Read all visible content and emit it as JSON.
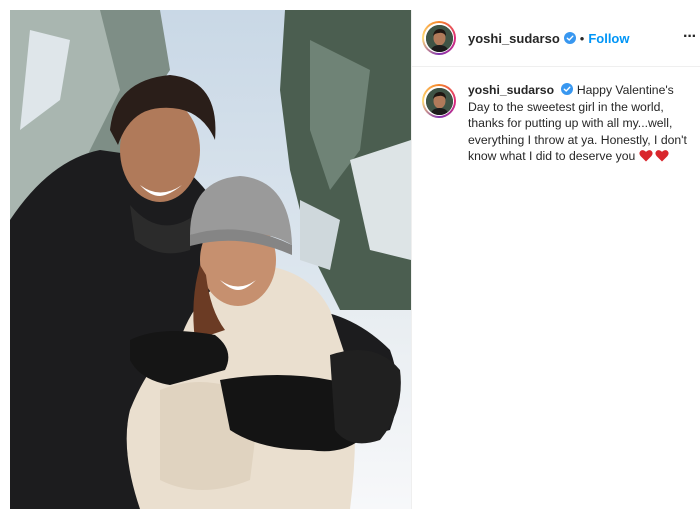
{
  "post": {
    "username": "yoshi_sudarso",
    "separator": "•",
    "follow_label": "Follow",
    "more_label": "···",
    "caption": "Happy Valentine's Day to the sweetest girl in the world, thanks for putting up with all my...well, everything I throw at ya. Honestly, I don't know what I did to deserve you",
    "caption_emojis": [
      "heart-icon",
      "heart-icon"
    ]
  },
  "colors": {
    "follow": "#0095f6",
    "verified": "#3897f0",
    "text": "#262626",
    "heart": "#d9262c"
  }
}
